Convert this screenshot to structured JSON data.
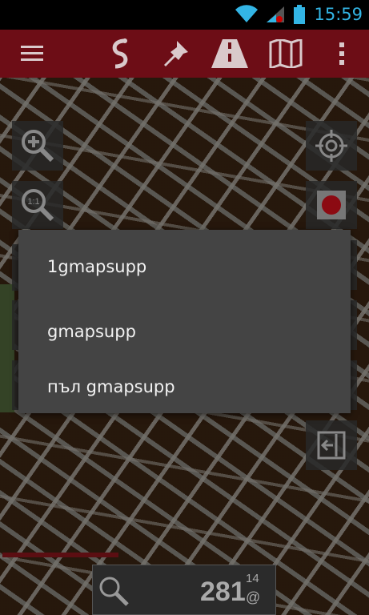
{
  "status_bar": {
    "time": "15:59"
  },
  "dialog": {
    "items": [
      "1gmapsupp",
      "gmapsupp",
      "пъл gmapsupp"
    ]
  },
  "bottom_panel": {
    "altitude": "281",
    "superscript": "14",
    "at_symbol": "@"
  },
  "colors": {
    "toolbar": "#6d0d16",
    "statusbar_accent": "#33b5e5",
    "dialog_bg": "#444444"
  }
}
